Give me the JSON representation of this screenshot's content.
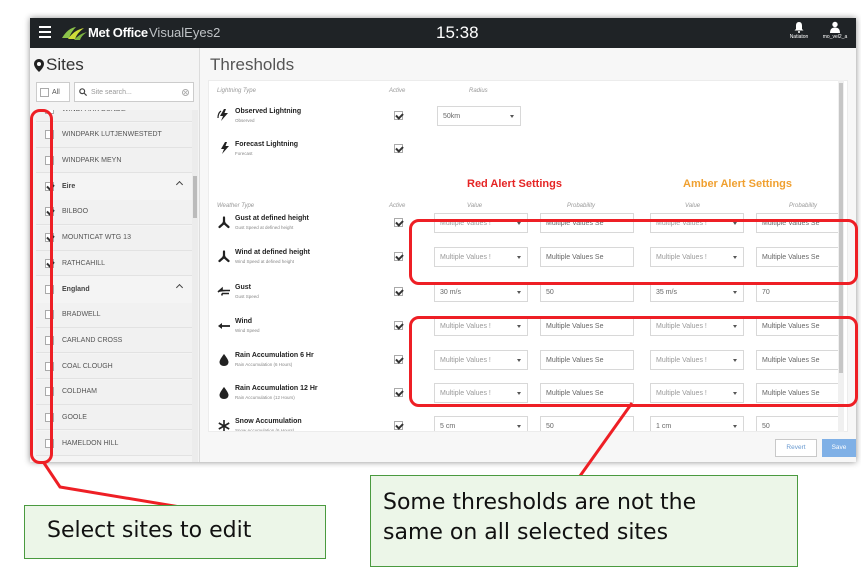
{
  "window": {
    "brand": "Met Office",
    "product": "VisualEyes2",
    "clock": "15:38",
    "user_1": "Natiaton",
    "user_2": "mo_vel2_a"
  },
  "sidebar": {
    "title": "Sites",
    "all_label": "All",
    "search_placeholder": "Site search...",
    "items": [
      {
        "label": "WINDPARK BUNDE",
        "kind": "site",
        "checked": false
      },
      {
        "label": "WINDPARK LUTJENWESTEDT",
        "kind": "site",
        "checked": false
      },
      {
        "label": "WINDPARK MEYN",
        "kind": "site",
        "checked": false
      },
      {
        "label": "Eire",
        "kind": "group",
        "checked": true
      },
      {
        "label": "BILBOO",
        "kind": "site",
        "checked": true
      },
      {
        "label": "MOUNTICAT WTG 13",
        "kind": "site",
        "checked": true
      },
      {
        "label": "RATHCAHILL",
        "kind": "site",
        "checked": true
      },
      {
        "label": "England",
        "kind": "group",
        "checked": false
      },
      {
        "label": "BRADWELL",
        "kind": "site",
        "checked": false
      },
      {
        "label": "CARLAND CROSS",
        "kind": "site",
        "checked": false
      },
      {
        "label": "COAL CLOUGH",
        "kind": "site",
        "checked": false
      },
      {
        "label": "COLDHAM",
        "kind": "site",
        "checked": false
      },
      {
        "label": "GOOLE",
        "kind": "site",
        "checked": false
      },
      {
        "label": "HAMELDON HILL",
        "kind": "site",
        "checked": false
      }
    ]
  },
  "main": {
    "title": "Thresholds",
    "lightning": {
      "type_header": "Lightning Type",
      "active_header": "Active",
      "radius_header": "Radius",
      "rows": [
        {
          "name": "Observed Lightning",
          "sub": "Observed",
          "active": true,
          "radius": "50km"
        },
        {
          "name": "Forecast Lightning",
          "sub": "Forecast",
          "active": true
        }
      ]
    },
    "red_title": "Red Alert Settings",
    "amber_title": "Amber Alert Settings",
    "weather_type_header": "Weather Type",
    "active_header": "Active",
    "value_header": "Value",
    "probability_header": "Probability",
    "rows": [
      {
        "name": "Gust at defined height",
        "sub": "Gust Speed at defined height",
        "active": true,
        "red_value": "Multiple Values !",
        "red_prob": "Multiple Values Se",
        "amber_value": "Multiple Values !",
        "amber_prob": "Multiple Values Se"
      },
      {
        "name": "Wind at defined height",
        "sub": "Wind Speed at defined height",
        "active": true,
        "red_value": "Multiple Values !",
        "red_prob": "Multiple Values Se",
        "amber_value": "Multiple Values !",
        "amber_prob": "Multiple Values Se"
      },
      {
        "name": "Gust",
        "sub": "Gust Speed",
        "active": true,
        "red_value": "30 m/s",
        "red_prob": "50",
        "amber_value": "35 m/s",
        "amber_prob": "70"
      },
      {
        "name": "Wind",
        "sub": "Wind Speed",
        "active": true,
        "red_value": "Multiple Values !",
        "red_prob": "Multiple Values Se",
        "amber_value": "Multiple Values !",
        "amber_prob": "Multiple Values Se"
      },
      {
        "name": "Rain Accumulation 6 Hr",
        "sub": "Rain Accumulation (6 Hours)",
        "active": true,
        "red_value": "Multiple Values !",
        "red_prob": "Multiple Values Se",
        "amber_value": "Multiple Values !",
        "amber_prob": "Multiple Values Se"
      },
      {
        "name": "Rain Accumulation 12 Hr",
        "sub": "Rain Accumulation (12 Hours)",
        "active": true,
        "red_value": "Multiple Values !",
        "red_prob": "Multiple Values Se",
        "amber_value": "Multiple Values !",
        "amber_prob": "Multiple Values Se"
      },
      {
        "name": "Snow Accumulation",
        "sub": "Snow Accumulation (6 Hours)",
        "active": true,
        "red_value": "5 cm",
        "red_prob": "50",
        "amber_value": "1 cm",
        "amber_prob": "50"
      }
    ],
    "revert_label": "Revert",
    "save_label": "Save"
  },
  "annotations": {
    "sites_callout": "Select sites to edit",
    "thresholds_callout_1": "Some thresholds are not the",
    "thresholds_callout_2": "same on all selected sites"
  },
  "colors": {
    "red_alert": "#e52424",
    "amber_alert": "#f0a030",
    "annotation_red": "#ee1f25",
    "callout_border": "#4a9a3f",
    "topbar": "#1f2326"
  }
}
